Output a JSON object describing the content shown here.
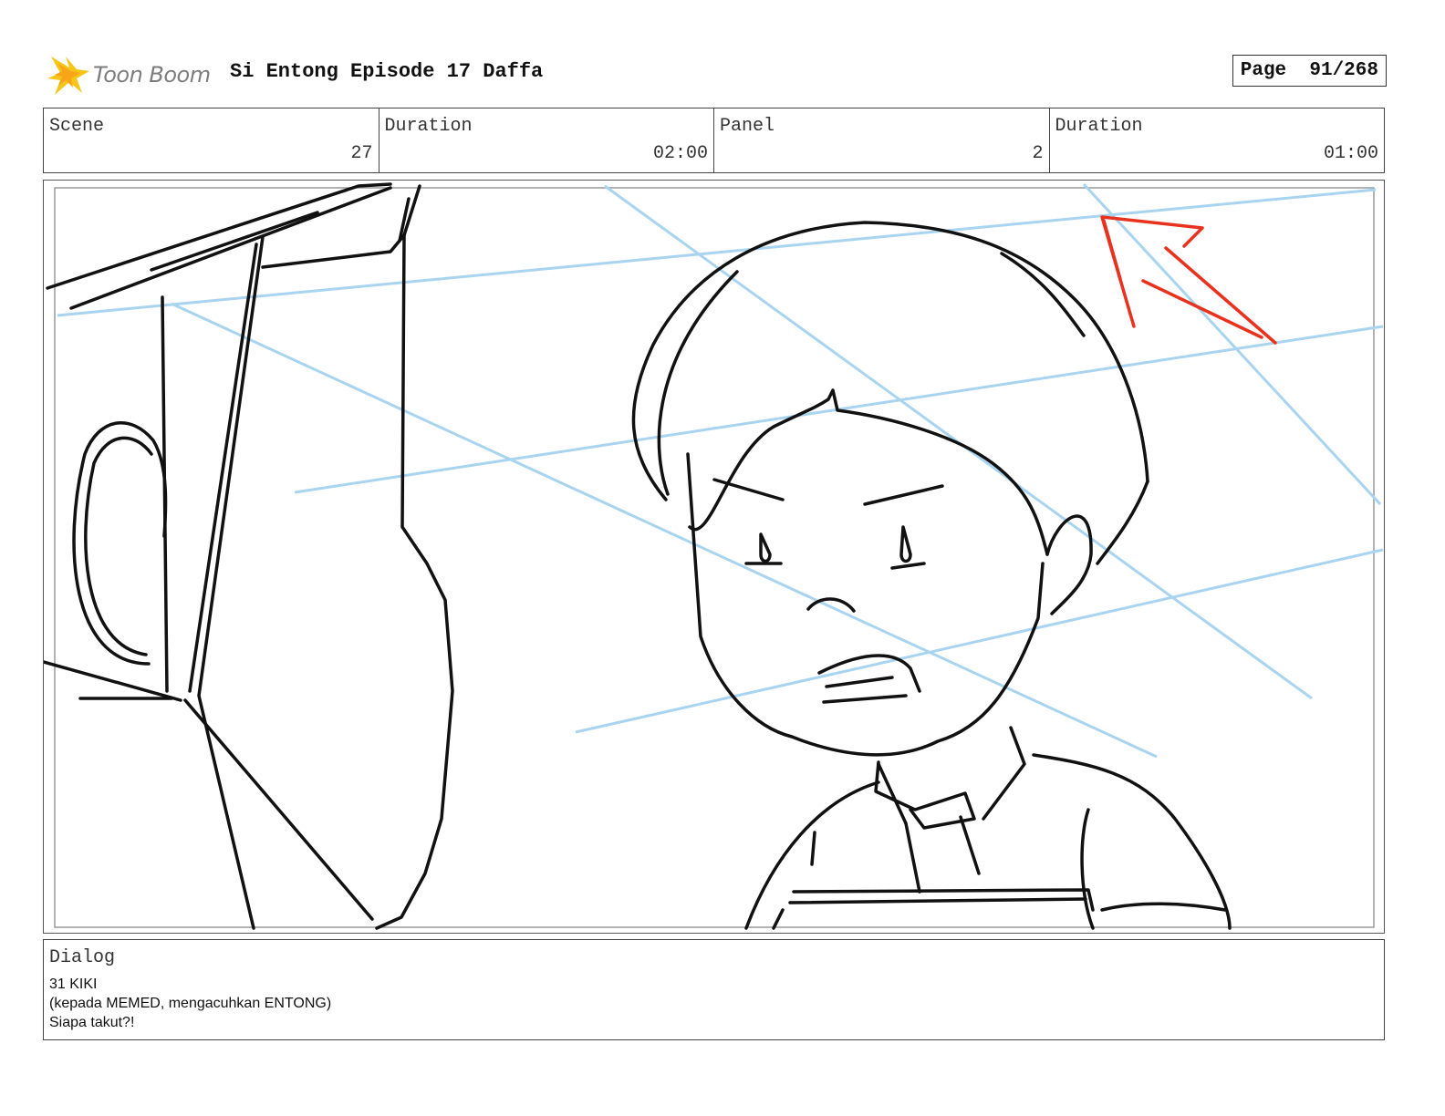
{
  "header": {
    "brand": "Toon Boom",
    "title": "Si Entong Episode 17 Daffa",
    "page_label": "Page",
    "page_value": "91/268"
  },
  "info": {
    "scene_label": "Scene",
    "scene_value": "27",
    "duration1_label": "Duration",
    "duration1_value": "02:00",
    "panel_label": "Panel",
    "panel_value": "2",
    "duration2_label": "Duration",
    "duration2_value": "01:00"
  },
  "dialog": {
    "label": "Dialog",
    "lines": [
      "31 KIKI",
      "(kepada MEMED, mengacuhkan ENTONG)",
      "Siapa takut?!"
    ]
  },
  "colors": {
    "logo_star": "#f5c518",
    "guide_lines": "#a8d4f0",
    "arrow": "#e8321e",
    "ink": "#111111"
  },
  "icons": {
    "logo": "toon-boom-star-logo",
    "arrow": "red-arrow-up-left"
  }
}
